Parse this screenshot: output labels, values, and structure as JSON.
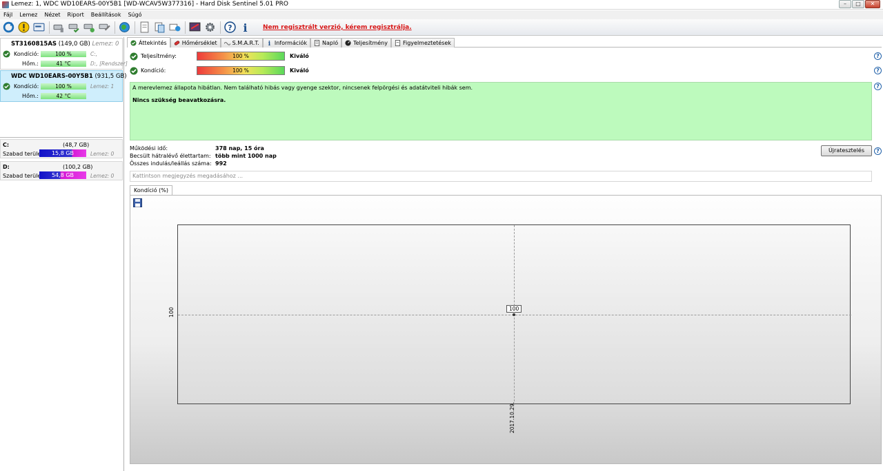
{
  "window": {
    "title": "Lemez: 1, WDC WD10EARS-00Y5B1 [WD-WCAV5W377316]  -  Hard Disk Sentinel 5.01 PRO",
    "controls": [
      "–",
      "□",
      "✕"
    ]
  },
  "menu": [
    "Fájl",
    "Lemez",
    "Nézet",
    "Riport",
    "Beállítások",
    "Súgó"
  ],
  "toolbar": {
    "registration_warning": "Nem regisztrált verzió, kérem regisztrálja."
  },
  "disks": [
    {
      "name": "ST3160815AS",
      "size": "(149,0 GB)",
      "disk_label": "Lemez: 0",
      "health_label": "Kondíció:",
      "health": "100 %",
      "temp_label": "Hőm.:",
      "temp": "41 °C",
      "side1": "C:,",
      "side2": "D:, [Rendszer]"
    },
    {
      "name": "WDC WD10EARS-00Y5B1",
      "size": "(931,5 GB)",
      "health_label": "Kondíció:",
      "health": "100 %",
      "temp_label": "Hőm.:",
      "temp": "42 °C",
      "side1": "Lemez: 1"
    }
  ],
  "volumes": [
    {
      "name": "C:",
      "size": "(48,7 GB)",
      "free_label": "Szabad terület",
      "free": "15,8 GB",
      "disk": "Lemez: 0"
    },
    {
      "name": "D:",
      "size": "(100,2 GB)",
      "free_label": "Szabad terület",
      "free": "54,8 GB",
      "disk": "Lemez: 0"
    }
  ],
  "tabs": [
    "Áttekintés",
    "Hőmérséklet",
    "S.M.A.R.T.",
    "Információk",
    "Napló",
    "Teljesítmény",
    "Figyelmeztetések"
  ],
  "metrics": {
    "performance": {
      "label": "Teljesítmény:",
      "value": "100 %",
      "rating": "Kiváló"
    },
    "health": {
      "label": "Kondíció:",
      "value": "100 %",
      "rating": "Kiváló"
    }
  },
  "status": {
    "message": "A merevlemez állapota hibátlan. Nem található hibás vagy gyenge szektor, nincsenek felpörgési és adatátviteli hibák sem.",
    "action": "Nincs szükség beavatkozásra."
  },
  "info": [
    {
      "label": "Működési idő:",
      "value": "378 nap, 15 óra"
    },
    {
      "label": "Becsült hátralévő élettartam:",
      "value": "több mint 1000 nap"
    },
    {
      "label": "Összes indulás/leállás száma:",
      "value": "992"
    }
  ],
  "reset_button": "Újratesztelés",
  "note_placeholder": "Kattintson megjegyzés megadásához ...",
  "chart_tab": "Kondíció  (%)",
  "help_glyph": "?",
  "chart_data": {
    "type": "line",
    "x": [
      "2017.10.29."
    ],
    "series": [
      {
        "values": [
          100
        ]
      }
    ],
    "point_labels": [
      "100"
    ],
    "ytick_labels": [
      "100"
    ],
    "xtick_labels": [
      "2017.10.29."
    ]
  }
}
